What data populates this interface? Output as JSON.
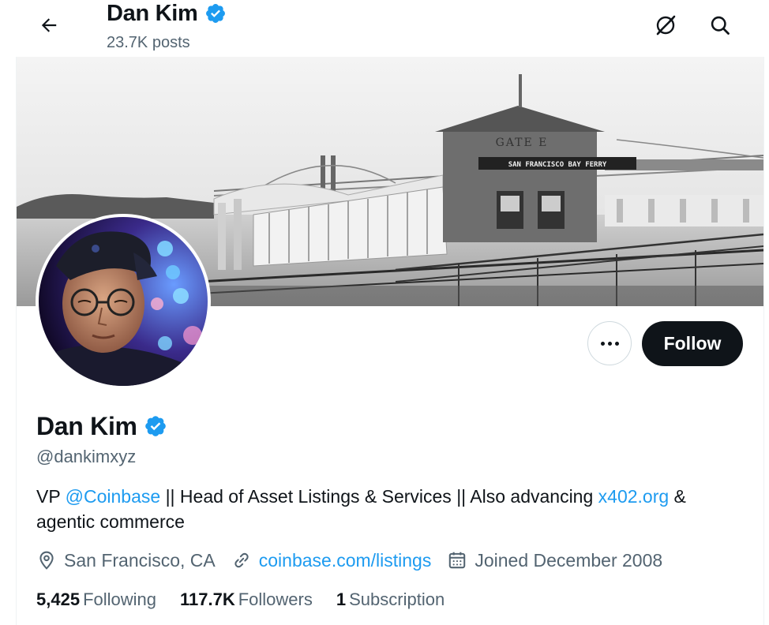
{
  "header": {
    "name": "Dan Kim",
    "posts_count": "23.7K posts"
  },
  "profile": {
    "name": "Dan Kim",
    "handle": "@dankimxyz",
    "follow_label": "Follow",
    "bio": {
      "prefix": "VP ",
      "mention": "@Coinbase",
      "middle": " || Head of Asset Listings & Services || Also advancing ",
      "link": "x402.org",
      "suffix": " & agentic commerce"
    },
    "location": "San Francisco, CA",
    "website": "coinbase.com/listings",
    "joined": "Joined December 2008",
    "stats": {
      "following_count": "5,425",
      "following_label": "Following",
      "followers_count": "117.7K",
      "followers_label": "Followers",
      "subscriptions_count": "1",
      "subscriptions_label": "Subscription"
    }
  },
  "banner": {
    "sign_gate": "GATE E",
    "sign_ferry": "SAN FRANCISCO BAY FERRY"
  },
  "icons": {
    "back": "arrow-left-icon",
    "grok": "grok-icon",
    "search": "search-icon",
    "verified": "verified-badge-icon",
    "location": "location-pin-icon",
    "link": "link-icon",
    "calendar": "calendar-icon",
    "more": "more-dots-icon"
  },
  "colors": {
    "accent": "#1d9bf0",
    "text": "#0f1419",
    "secondary": "#536471",
    "follow_bg": "#0f1419"
  }
}
